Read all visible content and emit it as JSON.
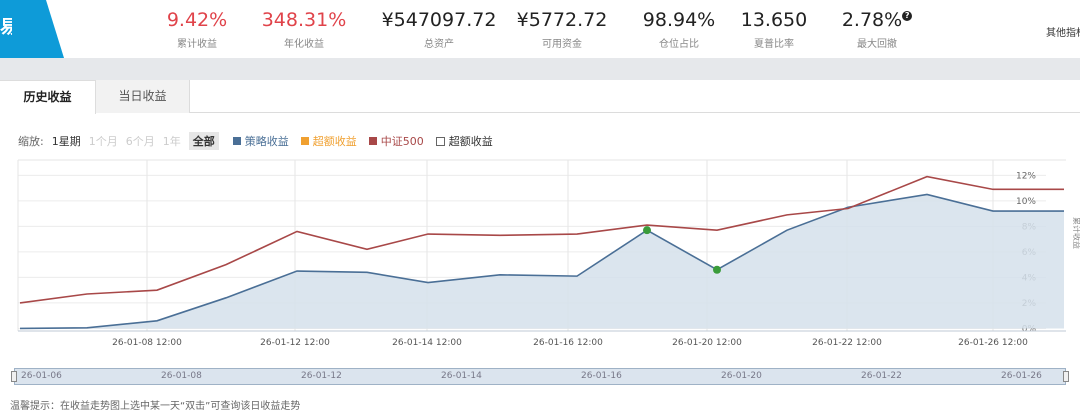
{
  "header": {
    "brand_text": "易",
    "other_link": "其他指标",
    "stats": [
      {
        "value": "9.42%",
        "label": "累计收益",
        "color": "red"
      },
      {
        "value": "348.31%",
        "label": "年化收益",
        "color": "red"
      },
      {
        "value": "¥547097.72",
        "label": "总资产",
        "color": "dark"
      },
      {
        "value": "¥5772.72",
        "label": "可用资金",
        "color": "dark"
      },
      {
        "value": "98.94%",
        "label": "仓位占比",
        "color": "dark"
      },
      {
        "value": "13.650",
        "label": "夏普比率",
        "color": "dark"
      },
      {
        "value": "2.78%",
        "label": "最大回撤",
        "color": "dark",
        "help": "?"
      }
    ]
  },
  "tabs": [
    {
      "label": "历史收益",
      "active": true
    },
    {
      "label": "当日收益",
      "active": false
    }
  ],
  "toolbar": {
    "zoom_label": "缩放:",
    "zoom_options": [
      {
        "label": "1星期",
        "state": "normal"
      },
      {
        "label": "1个月",
        "state": "disabled"
      },
      {
        "label": "6个月",
        "state": "disabled"
      },
      {
        "label": "1年",
        "state": "disabled"
      },
      {
        "label": "全部",
        "state": "selected"
      }
    ],
    "legend": [
      {
        "label": "策略收益",
        "color": "#4a6f96",
        "type": "swatch"
      },
      {
        "label": "超额收益",
        "color": "#f0a030",
        "type": "swatch"
      },
      {
        "label": "中证500",
        "color": "#a84848",
        "type": "swatch"
      },
      {
        "label": "超额收益",
        "color": "#333333",
        "type": "checkbox"
      }
    ]
  },
  "chart_data": {
    "type": "area",
    "x": [
      "26-01-06",
      "26-01-07",
      "26-01-08",
      "26-01-09",
      "26-01-12",
      "26-01-13",
      "26-01-14",
      "26-01-15",
      "26-01-16",
      "26-01-19",
      "26-01-20",
      "26-01-21",
      "26-01-22",
      "26-01-23",
      "26-01-26",
      "26-01-27"
    ],
    "x_tick_labels": [
      "26-01-08 12:00",
      "26-01-12 12:00",
      "26-01-14 12:00",
      "26-01-16 12:00",
      "26-01-20 12:00",
      "26-01-22 12:00",
      "26-01-26 12:00"
    ],
    "y_tick_labels": [
      "0%",
      "2%",
      "4%",
      "6%",
      "8%",
      "10%",
      "12%"
    ],
    "ylim": [
      -0.2,
      13.2
    ],
    "ylabel": "累计收益",
    "grid": true,
    "series": [
      {
        "name": "策略收益",
        "color": "#4a6f96",
        "fill": "#d5e0eb",
        "values": [
          0.0,
          0.05,
          0.6,
          2.4,
          4.5,
          4.4,
          3.6,
          4.2,
          4.1,
          7.7,
          4.6,
          7.7,
          9.5,
          10.5,
          9.2,
          9.2
        ]
      },
      {
        "name": "中证500",
        "color": "#a84848",
        "values": [
          2.0,
          2.7,
          3.0,
          5.0,
          7.6,
          6.2,
          7.4,
          7.3,
          7.4,
          8.1,
          7.7,
          8.9,
          9.4,
          11.9,
          10.9,
          10.9
        ]
      }
    ],
    "markers": [
      {
        "series": 0,
        "index": 9,
        "color": "#3a9c3a"
      },
      {
        "series": 0,
        "index": 10,
        "color": "#3a9c3a"
      }
    ],
    "navigator_labels": [
      "26-01-06",
      "26-01-08",
      "26-01-12",
      "26-01-14",
      "26-01-16",
      "26-01-20",
      "26-01-22",
      "26-01-26"
    ]
  },
  "footer": {
    "tip": "温馨提示：在收益走势图上选中某一天“双击”可查询该日收益走势"
  }
}
